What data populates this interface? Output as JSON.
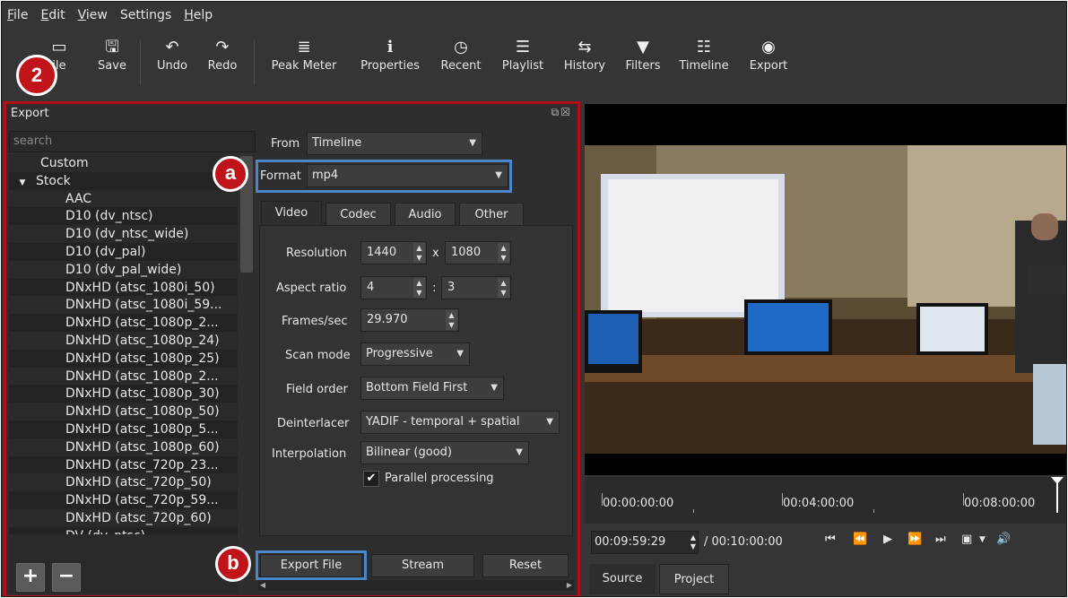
{
  "menu": [
    {
      "label": "File",
      "u": "F",
      "rest": "ile"
    },
    {
      "label": "Edit",
      "u": "E",
      "rest": "dit"
    },
    {
      "label": "View",
      "u": "V",
      "rest": "iew"
    },
    {
      "label": "Settings",
      "u": "",
      "rest": "Settings"
    },
    {
      "label": "Help",
      "u": "H",
      "rest": "elp"
    }
  ],
  "toolbar": {
    "open_label": "ile",
    "save_label": "Save",
    "undo_label": "Undo",
    "redo_label": "Redo",
    "peak_meter_label": "Peak Meter",
    "properties_label": "Properties",
    "recent_label": "Recent",
    "playlist_label": "Playlist",
    "history_label": "History",
    "filters_label": "Filters",
    "timeline_label": "Timeline",
    "export_label": "Export"
  },
  "badges": {
    "step": "2",
    "a": "a",
    "b": "b"
  },
  "export": {
    "title": "Export",
    "search_placeholder": "search",
    "tree": [
      "Custom",
      "Stock",
      "AAC",
      "D10 (dv_ntsc)",
      "D10 (dv_ntsc_wide)",
      "D10 (dv_pal)",
      "D10 (dv_pal_wide)",
      "DNxHD (atsc_1080i_50)",
      "DNxHD (atsc_1080i_59...",
      "DNxHD (atsc_1080p_2...",
      "DNxHD (atsc_1080p_24)",
      "DNxHD (atsc_1080p_25)",
      "DNxHD (atsc_1080p_2...",
      "DNxHD (atsc_1080p_30)",
      "DNxHD (atsc_1080p_50)",
      "DNxHD (atsc_1080p_5...",
      "DNxHD (atsc_1080p_60)",
      "DNxHD (atsc_720p_23...",
      "DNxHD (atsc_720p_50)",
      "DNxHD (atsc_720p_59...",
      "DNxHD (atsc_720p_60)",
      "DV (dv_ntsc)"
    ],
    "from_label": "From",
    "from_value": "Timeline",
    "format_label": "Format",
    "format_value": "mp4",
    "tabs": [
      "Video",
      "Codec",
      "Audio",
      "Other"
    ],
    "resolution_label": "Resolution",
    "res_w": "1440",
    "res_x": "x",
    "res_h": "1080",
    "aspect_label": "Aspect ratio",
    "aspect_w": "4",
    "aspect_sep": ":",
    "aspect_h": "3",
    "fps_label": "Frames/sec",
    "fps_value": "29.970",
    "scan_label": "Scan mode",
    "scan_value": "Progressive",
    "field_label": "Field order",
    "field_value": "Bottom Field First",
    "deint_label": "Deinterlacer",
    "deint_value": "YADIF - temporal + spatial",
    "interp_label": "Interpolation",
    "interp_value": "Bilinear (good)",
    "parallel_label": "Parallel processing",
    "export_file": "Export File",
    "stream": "Stream",
    "reset": "Reset"
  },
  "timeline": {
    "t0": "00:00:00:00",
    "t1": "00:04:00:00",
    "t2": "00:08:00:00",
    "current": "00:09:59:29",
    "total": "/ 00:10:00:00"
  },
  "bottom_tabs": {
    "source": "Source",
    "project": "Project"
  },
  "colors": {
    "accent_red": "#b11116",
    "highlight_blue": "#4a86c8"
  }
}
